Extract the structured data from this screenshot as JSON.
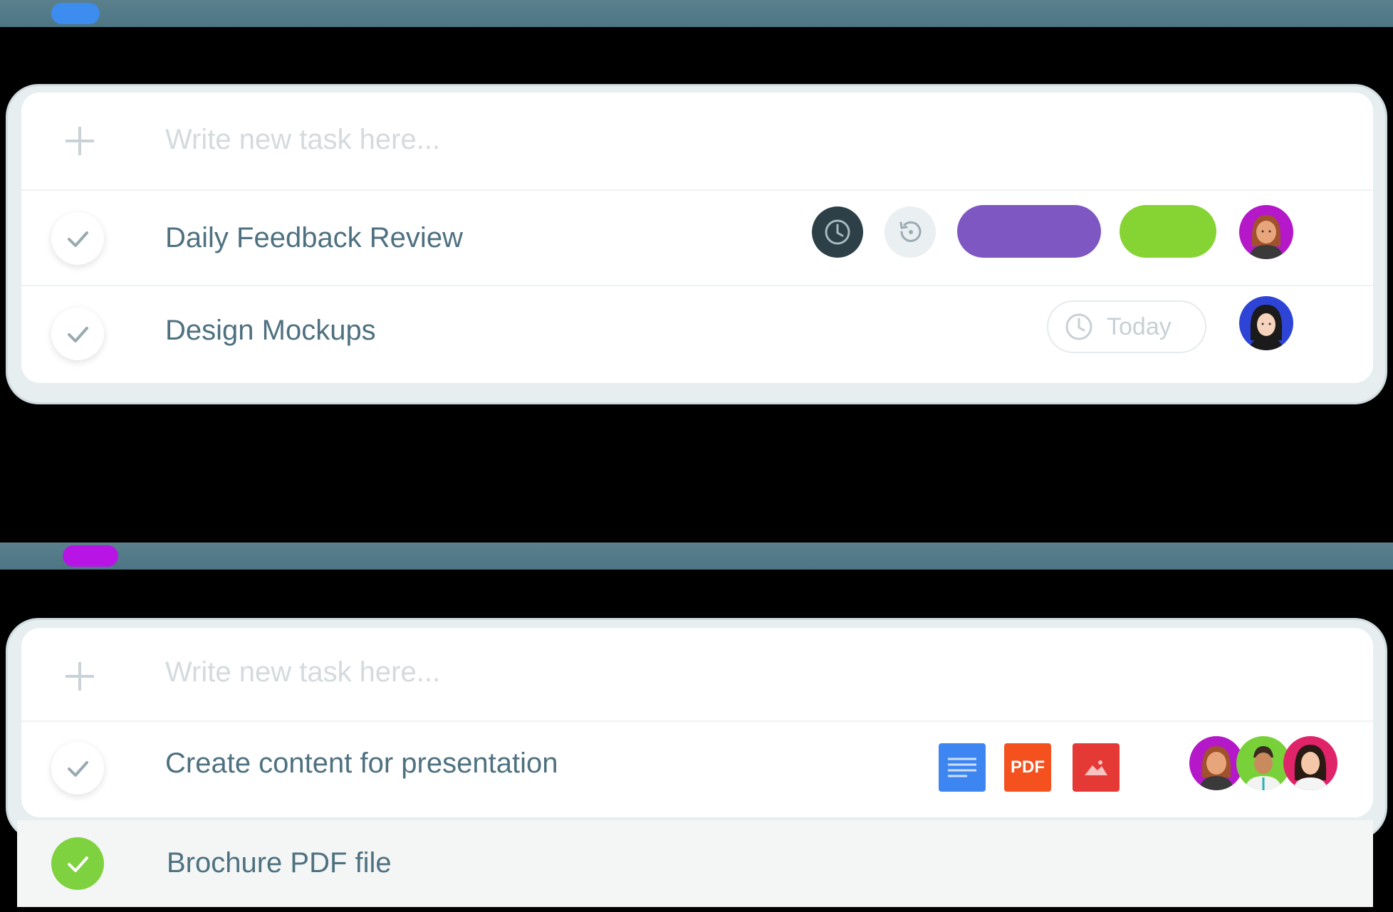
{
  "sections": [
    {
      "dot_color": "#3d8cf0",
      "header_label": "",
      "input_placeholder": "Write new task here...",
      "tasks": [
        {
          "title": "Daily Feedback Review",
          "clock_icon": "clock-icon",
          "repeat_icon": "repeat-icon",
          "tag_colors": [
            "#7e57c2",
            "#86d433"
          ],
          "assignee_avatar_bg": "#b418c8"
        },
        {
          "title": "Design Mockups",
          "due_label": "Today",
          "assignee_avatar_bg": "#2e44d6"
        }
      ]
    },
    {
      "dot_color": "#b814e6",
      "header_label": "",
      "input_placeholder": "Write new task here...",
      "tasks": [
        {
          "title": "Create content for presentation",
          "attachments": [
            {
              "type": "document",
              "color": "#3d86f2"
            },
            {
              "type": "pdf",
              "label": "PDF",
              "color": "#f4511e"
            },
            {
              "type": "image",
              "color": "#e53935"
            }
          ],
          "assignee_avatar_bgs": [
            "#b418c8",
            "#79d13a",
            "#e0246a"
          ]
        },
        {
          "title": "Brochure PDF file",
          "completed": true
        }
      ]
    }
  ]
}
